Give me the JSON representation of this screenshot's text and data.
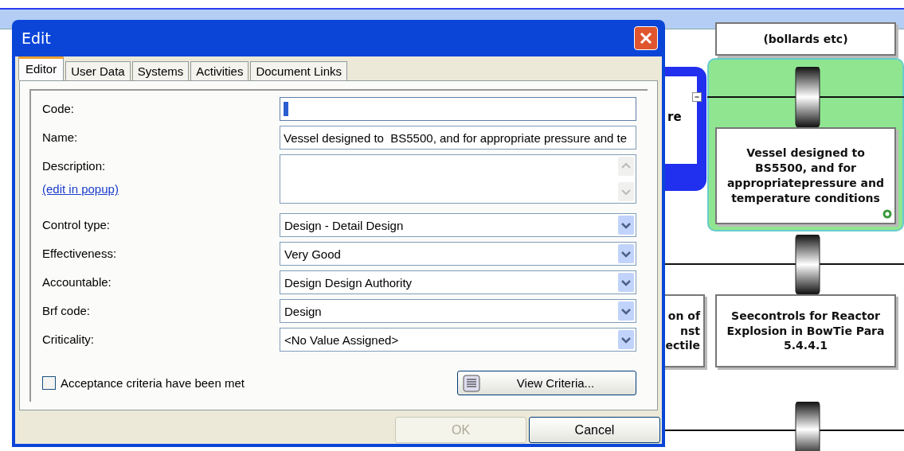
{
  "dialog": {
    "title": "Edit",
    "tabs": [
      {
        "label": "Editor",
        "selected": true
      },
      {
        "label": "User Data",
        "selected": false
      },
      {
        "label": "Systems",
        "selected": false
      },
      {
        "label": "Activities",
        "selected": false
      },
      {
        "label": "Document Links",
        "selected": false
      }
    ],
    "fields": [
      {
        "kind": "text",
        "label": "Code:",
        "focused": true
      },
      {
        "kind": "text",
        "label": "Name:",
        "value": "Vessel designed to  BS5500, and for appropriate pressure and te",
        "focused": false
      },
      {
        "kind": "textarea",
        "label": "Description:",
        "link": "(edit in popup)"
      },
      {
        "kind": "select",
        "label": "Control type:",
        "value": "Design - Detail Design"
      },
      {
        "kind": "select",
        "label": "Effectiveness:",
        "value": "Very Good"
      },
      {
        "kind": "select",
        "label": "Accountable:",
        "value": "Design Design Authority"
      },
      {
        "kind": "select",
        "label": "Brf code:",
        "value": "Design"
      },
      {
        "kind": "select",
        "label": "Criticality:",
        "value": "<No Value Assigned>"
      }
    ],
    "checkbox": {
      "label": "Acceptance criteria have been met",
      "checked": false
    },
    "view_button": "View Criteria...",
    "buttons": [
      {
        "label": "OK",
        "disabled": true
      },
      {
        "label": "Cancel",
        "disabled": false
      }
    ]
  },
  "diagram": {
    "top_card": "(bollards etc)",
    "left_card": "re",
    "selected_card": "Vessel designed to BS5500, and for appropriatepressure and temperature conditions",
    "partial_card_lines": [
      "on of",
      "nst",
      "ectile"
    ],
    "lower_card": "Seecontrols for Reactor Explosion in BowTie Para 5.4.4.1"
  }
}
